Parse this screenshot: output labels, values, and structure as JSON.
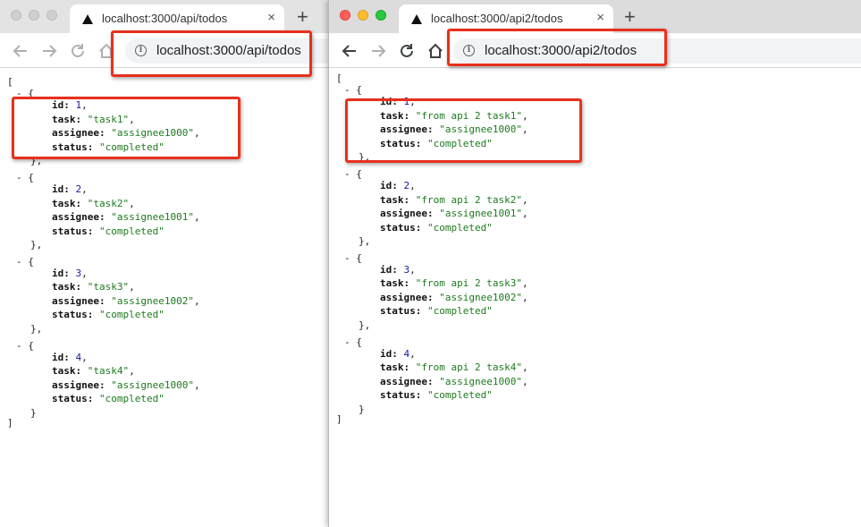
{
  "windows": {
    "left": {
      "tab_title": "localhost:3000/api/todos",
      "tab_close": "×",
      "new_tab": "+",
      "address": "localhost:3000/api/todos",
      "open_bracket": "[",
      "close_bracket": "]",
      "items": [
        {
          "id": "1",
          "task": "\"task1\"",
          "assignee": "\"assignee1000\"",
          "status": "\"completed\""
        },
        {
          "id": "2",
          "task": "\"task2\"",
          "assignee": "\"assignee1001\"",
          "status": "\"completed\""
        },
        {
          "id": "3",
          "task": "\"task3\"",
          "assignee": "\"assignee1002\"",
          "status": "\"completed\""
        },
        {
          "id": "4",
          "task": "\"task4\"",
          "assignee": "\"assignee1000\"",
          "status": "\"completed\""
        }
      ]
    },
    "right": {
      "tab_title": "localhost:3000/api2/todos",
      "tab_close": "×",
      "new_tab": "+",
      "address": "localhost:3000/api2/todos",
      "open_bracket": "[",
      "close_bracket": "]",
      "items": [
        {
          "id": "1",
          "task": "\"from api 2 task1\"",
          "assignee": "\"assignee1000\"",
          "status": "\"completed\""
        },
        {
          "id": "2",
          "task": "\"from api 2 task2\"",
          "assignee": "\"assignee1001\"",
          "status": "\"completed\""
        },
        {
          "id": "3",
          "task": "\"from api 2 task3\"",
          "assignee": "\"assignee1002\"",
          "status": "\"completed\""
        },
        {
          "id": "4",
          "task": "\"from api 2 task4\"",
          "assignee": "\"assignee1000\"",
          "status": "\"completed\""
        }
      ]
    }
  },
  "json_view": {
    "keys": {
      "id": "id:",
      "task": "task:",
      "assignee": "assignee:",
      "status": "status:"
    },
    "object_open": "- {",
    "object_close": "},",
    "last_object_close": "}",
    "comma": ","
  },
  "colors": {
    "highlight": "#e8301c",
    "number": "#1a1aa6",
    "string": "#1d7a1d"
  },
  "icons": [
    "back-arrow-icon",
    "forward-arrow-icon",
    "reload-icon",
    "home-icon",
    "info-icon",
    "favicon-triangle-icon"
  ]
}
